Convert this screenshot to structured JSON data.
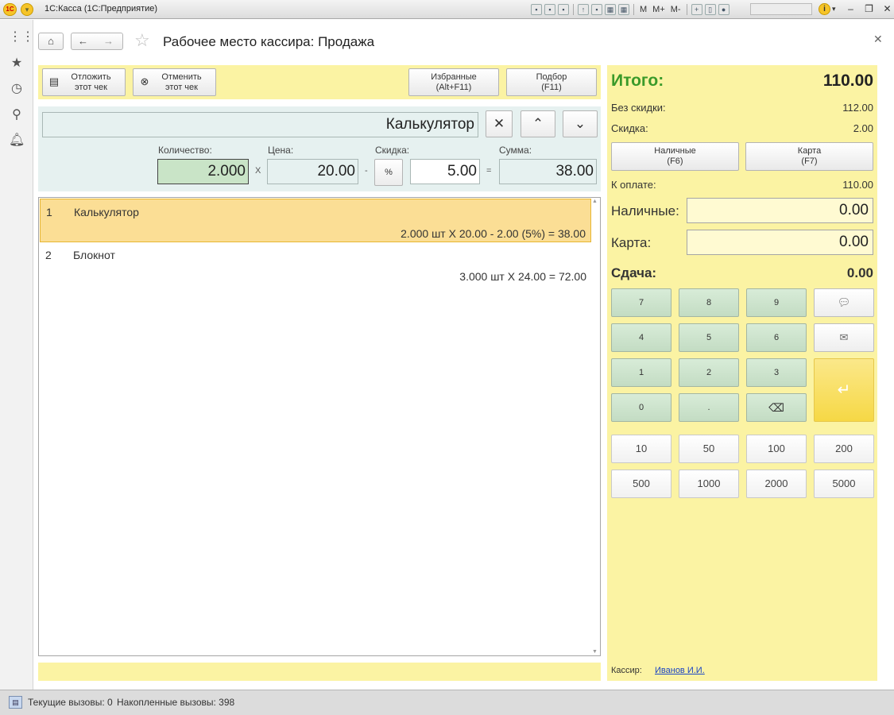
{
  "window": {
    "title": "1С:Касса  (1С:Предприятие)",
    "logo_text": "1С",
    "toolbar_letters": [
      "M",
      "M+",
      "M-"
    ]
  },
  "form": {
    "title": "Рабочее место кассира: Продажа"
  },
  "actions": {
    "postpone_line1": "Отложить",
    "postpone_line2": "этот чек",
    "cancel_line1": "Отменить",
    "cancel_line2": "этот чек",
    "favorites_line1": "Избранные",
    "favorites_line2": "(Alt+F11)",
    "selection_line1": "Подбор",
    "selection_line2": "(F11)"
  },
  "current_item": {
    "name": "Калькулятор",
    "qty_label": "Количество:",
    "qty": "2.000",
    "price_label": "Цена:",
    "price": "20.00",
    "discount_label": "Скидка:",
    "discount": "5.00",
    "sum_label": "Сумма:",
    "sum": "38.00",
    "op_times": "X",
    "op_minus": "-",
    "op_equals": "=",
    "percent": "%"
  },
  "lines": [
    {
      "num": "1",
      "name": "Калькулятор",
      "detail": "2.000 шт X 20.00 - 2.00 (5%) = 38.00"
    },
    {
      "num": "2",
      "name": "Блокнот",
      "detail": "3.000 шт X 24.00 = 72.00"
    }
  ],
  "totals": {
    "total_label": "Итого:",
    "total": "110.00",
    "no_discount_label": "Без скидки:",
    "no_discount": "112.00",
    "discount_label": "Скидка:",
    "discount": "2.00",
    "cash_btn_line1": "Наличные",
    "cash_btn_line2": "(F6)",
    "card_btn_line1": "Карта",
    "card_btn_line2": "(F7)",
    "to_pay_label": "К оплате:",
    "to_pay": "110.00",
    "cash_label": "Наличные:",
    "cash": "0.00",
    "card_label": "Карта:",
    "card": "0.00",
    "change_label": "Сдача:",
    "change": "0.00"
  },
  "keypad": {
    "k7": "7",
    "k8": "8",
    "k9": "9",
    "k4": "4",
    "k5": "5",
    "k6": "6",
    "k1": "1",
    "k2": "2",
    "k3": "3",
    "k0": "0",
    "kdot": "."
  },
  "bills": [
    "10",
    "50",
    "100",
    "200",
    "500",
    "1000",
    "2000",
    "5000"
  ],
  "cashier": {
    "label": "Кассир:",
    "name": "Иванов И.И."
  },
  "status": {
    "current_calls": "Текущие вызовы: 0",
    "accumulated_calls": "Накопленные вызовы: 398"
  },
  "colors": {
    "total_green": "#3a9a2a",
    "panel_yellow": "#fbf3a3",
    "selected_row": "#fbde95",
    "keypad_green": "#c3dcc3",
    "item_panel": "#e6f1f0"
  }
}
